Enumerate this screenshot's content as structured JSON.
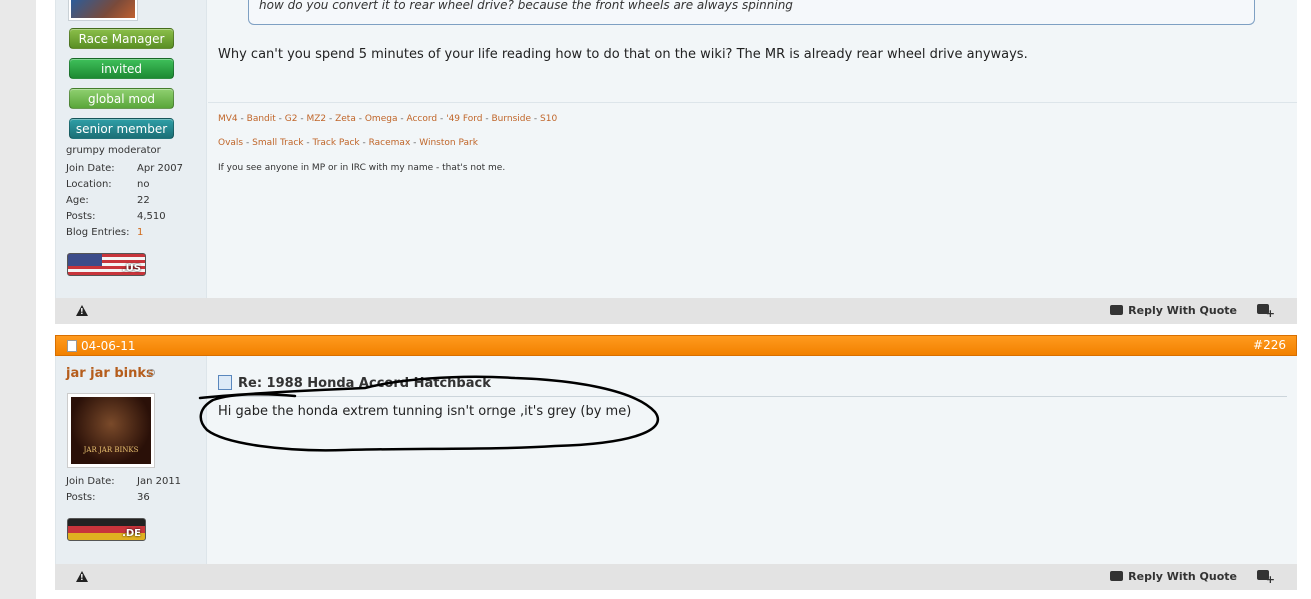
{
  "post1": {
    "user_ranks": {
      "race_manager": "Race Manager",
      "invited": "invited",
      "global_mod": "global mod",
      "senior_member": "senior member"
    },
    "user_title": "grumpy moderator",
    "info": {
      "join_date_label": "Join Date:",
      "join_date": "Apr 2007",
      "location_label": "Location:",
      "location": "no",
      "age_label": "Age:",
      "age": "22",
      "posts_label": "Posts:",
      "posts": "4,510",
      "blog_label": "Blog Entries:",
      "blog": "1"
    },
    "flag_code": ".US",
    "quote": "how do you convert it to rear wheel drive? because the front wheels are always spinning",
    "message": "Why can't you spend 5 minutes of your life reading how to do that on the wiki? The MR is already rear wheel drive anyways.",
    "signature": {
      "line1": [
        "MV4",
        "Bandit",
        "G2",
        "MZ2",
        "Zeta",
        "Omega",
        "Accord",
        "'49 Ford",
        "Burnside",
        "S10"
      ],
      "line2": [
        "Ovals",
        "Small Track",
        "Track Pack",
        "Racemax",
        "Winston Park"
      ],
      "separator": " - ",
      "note": "If you see anyone in MP or in IRC with my name - that's not me."
    }
  },
  "footer": {
    "reply_label": "Reply With Quote",
    "report_icon": "warning-icon",
    "multiquote_icon": "multiquote-icon"
  },
  "post2": {
    "date": "04-06-11",
    "number": "#226",
    "username": "jar jar binks",
    "avatar_caption": "JAR JAR BINKS",
    "info": {
      "join_date_label": "Join Date:",
      "join_date": "Jan 2011",
      "posts_label": "Posts:",
      "posts": "36"
    },
    "flag_code": ".DE",
    "title": "Re: 1988 Honda Accord Hatchback",
    "message": "Hi gabe the honda extrem tunning isn't ornge ,it's grey (by me)"
  },
  "colors": {
    "header_orange": "#f28100",
    "link_orange": "#c0662a",
    "username_brown": "#b55d1c"
  }
}
